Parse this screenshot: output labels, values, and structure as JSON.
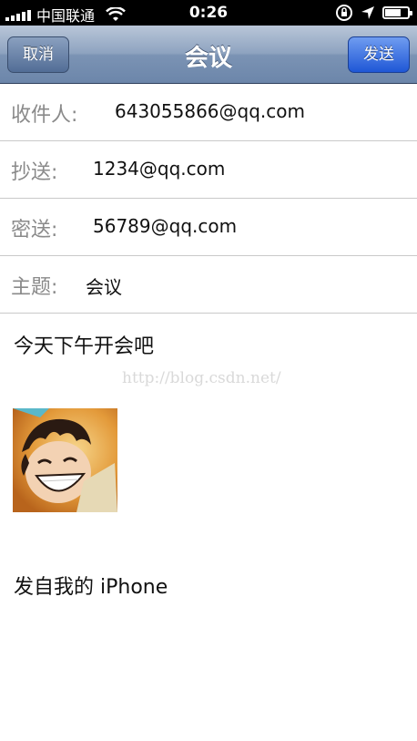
{
  "status_bar": {
    "carrier": "中国联通",
    "time": "0:26",
    "battery_level": 0.7
  },
  "nav": {
    "title": "会议",
    "cancel_label": "取消",
    "send_label": "发送"
  },
  "fields": {
    "to_label": "收件人:",
    "to_value": "643055866@qq.com",
    "cc_label": "抄送:",
    "cc_value": "1234@qq.com",
    "bcc_label": "密送:",
    "bcc_value": "56789@qq.com",
    "subject_label": "主题:",
    "subject_value": "会议"
  },
  "body": {
    "text": "今天下午开会吧",
    "watermark": "http://blog.csdn.net/",
    "signature": "发自我的 iPhone"
  },
  "icons": [
    "signal-icon",
    "wifi-icon",
    "rotation-lock-icon",
    "location-icon",
    "battery-icon"
  ]
}
